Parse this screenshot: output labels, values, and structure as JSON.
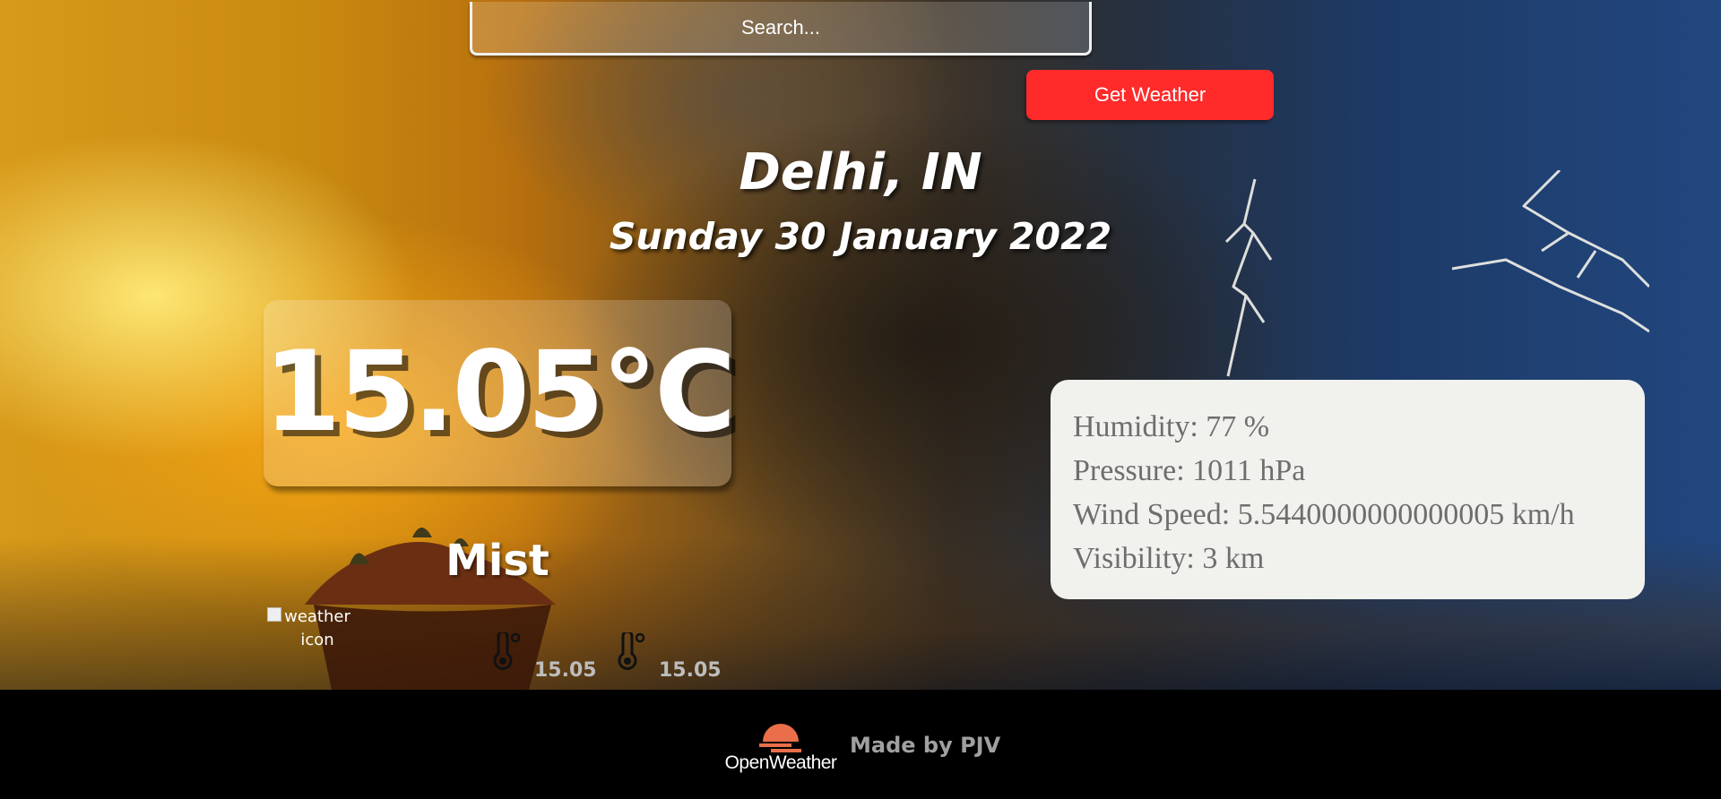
{
  "search": {
    "placeholder": "Search..."
  },
  "actions": {
    "get_weather_label": "Get Weather"
  },
  "location": {
    "city": "Delhi, IN",
    "date": "Sunday 30 January 2022"
  },
  "current": {
    "temperature": "15.05°C",
    "condition": "Mist",
    "icon_alt": "weather icon",
    "temp_min": "15.05",
    "temp_max": "15.05"
  },
  "details": {
    "humidity": "Humidity: 77 %",
    "pressure": "Pressure: 1011 hPa",
    "wind_speed": "Wind Speed: 5.5440000000000005 km/h",
    "visibility": "Visibility: 3 km"
  },
  "footer": {
    "brand": "OpenWeather",
    "credit": "Made by PJV"
  },
  "colors": {
    "button": "#ff2a2a",
    "details_card": "#f1f1ed",
    "details_text": "#6e6e6e",
    "brand_orange": "#eb6e4b",
    "footer_bg": "#000000"
  },
  "icons": [
    "thermometer-icon",
    "openweather-logo-icon"
  ]
}
